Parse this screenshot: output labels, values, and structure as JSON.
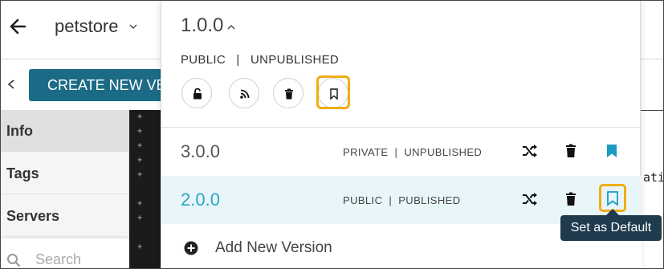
{
  "header": {
    "back_icon": "arrow-left-icon",
    "app_name": "petstore",
    "caret_icon": "chevron-down-icon"
  },
  "toolbar": {
    "collapse_icon": "chevron-left-icon",
    "create_label": "CREATE NEW VERSION"
  },
  "sidebar": {
    "items": [
      {
        "label": "Info",
        "active": true
      },
      {
        "label": "Tags",
        "active": false
      },
      {
        "label": "Servers",
        "active": false
      }
    ],
    "search_placeholder": "Search"
  },
  "editor": {
    "gutter_symbols": [
      "+",
      "+",
      "+",
      "+",
      "+",
      "+",
      "+",
      "+"
    ],
    "code_fragment": "atic"
  },
  "version_menu": {
    "current_version": "1.0.0",
    "current_caret_icon": "chevron-up-icon",
    "current_visibility": "PUBLIC",
    "current_status": "UNPUBLISHED",
    "separator": "|",
    "actions": [
      {
        "name": "unlock-icon"
      },
      {
        "name": "rss-icon"
      },
      {
        "name": "trash-icon"
      },
      {
        "name": "bookmark-outline-icon",
        "highlighted": true
      }
    ],
    "versions": [
      {
        "name": "3.0.0",
        "visibility": "PRIVATE",
        "status": "UNPUBLISHED",
        "is_default": true,
        "selected": false
      },
      {
        "name": "2.0.0",
        "visibility": "PUBLIC",
        "status": "PUBLISHED",
        "is_default": false,
        "selected": true
      }
    ],
    "add_label": "Add New Version",
    "tooltip": "Set as Default"
  },
  "colors": {
    "accent": "#1c6b86",
    "highlight": "#f0ad14",
    "selected_row": "#e8f6fa",
    "selected_text": "#2ba6c7",
    "bookmark_filled": "#1a9bc0",
    "tooltip_bg": "#1f3b4d"
  }
}
